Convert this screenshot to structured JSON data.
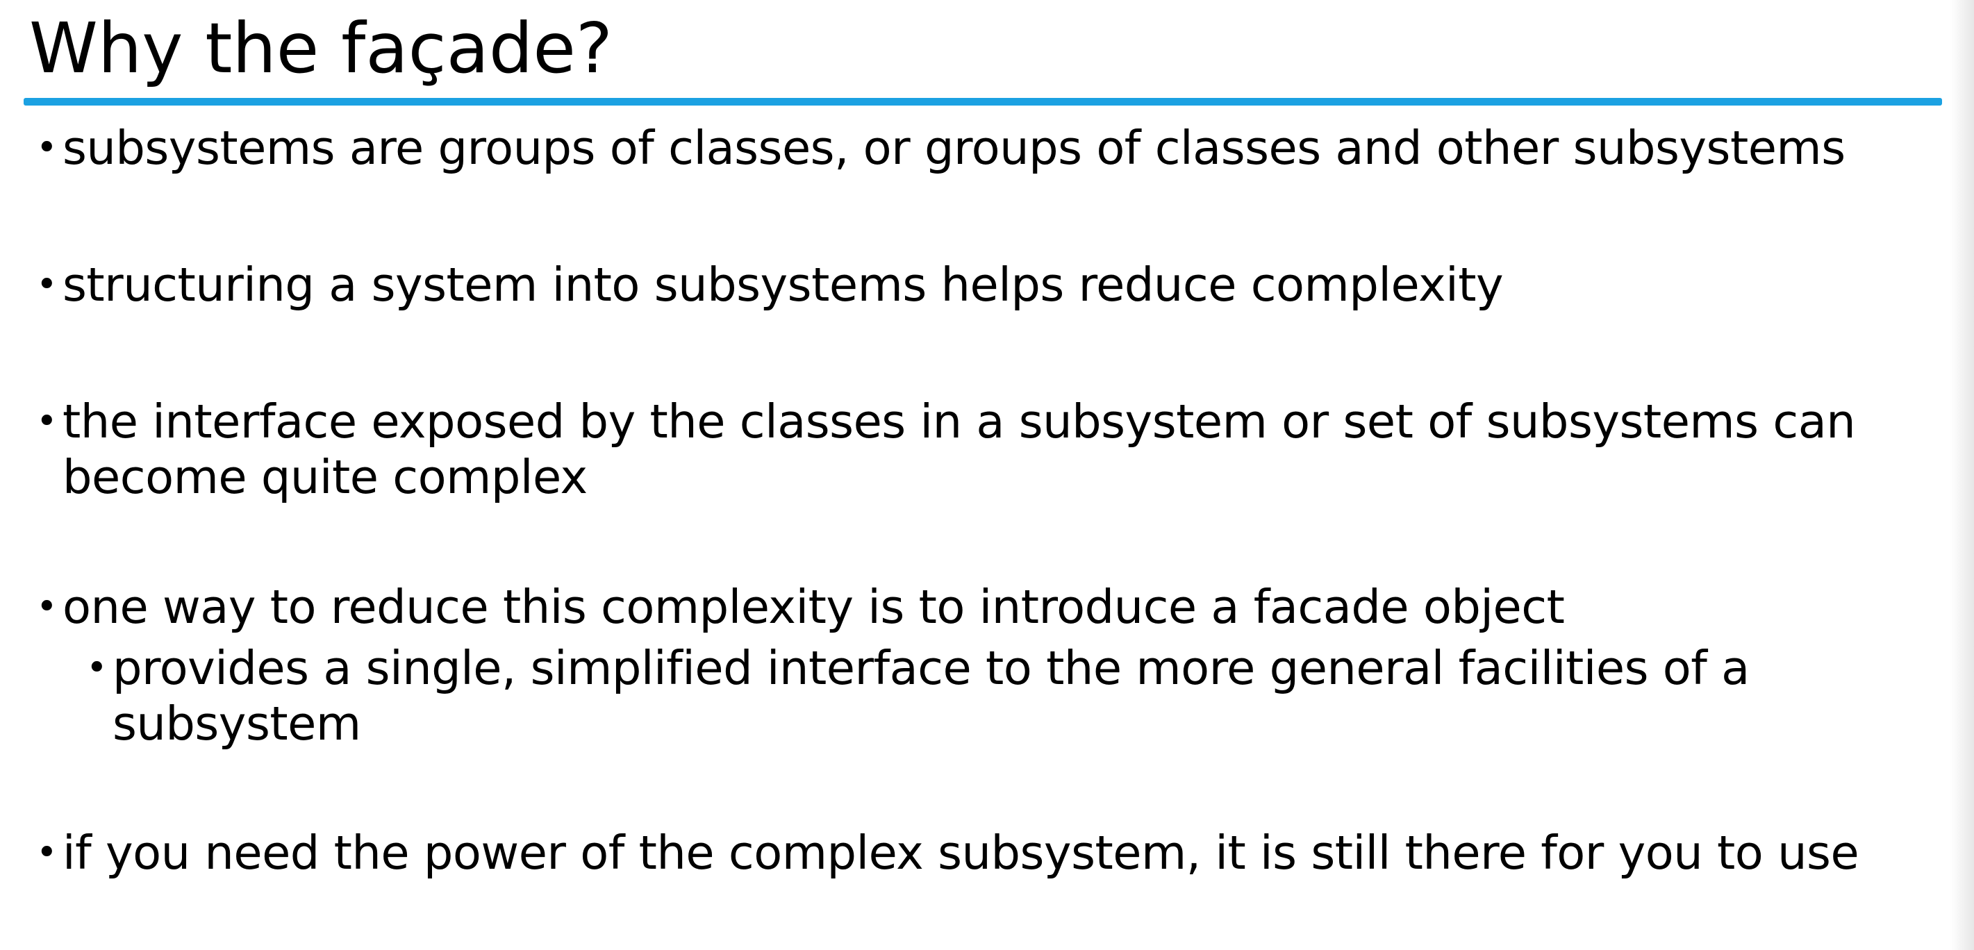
{
  "slide": {
    "title": "Why the façade?",
    "accent_color": "#1ba1e2",
    "bullet_glyph": "•",
    "bullets": [
      {
        "text": "subsystems are groups of classes, or groups of classes and other subsystems"
      },
      {
        "text": "structuring a system into subsystems helps reduce complexity"
      },
      {
        "line1": "the interface exposed by the classes in a subsystem or set of subsystems can",
        "line2": "become quite complex"
      },
      {
        "text": "one way to reduce this complexity is to introduce a facade object",
        "sub": {
          "line1": "provides a single, simplified interface to the more general facilities of a",
          "line2": "subsystem"
        }
      },
      {
        "text": "if you need the power of the complex subsystem, it is still there for you to use"
      }
    ]
  }
}
